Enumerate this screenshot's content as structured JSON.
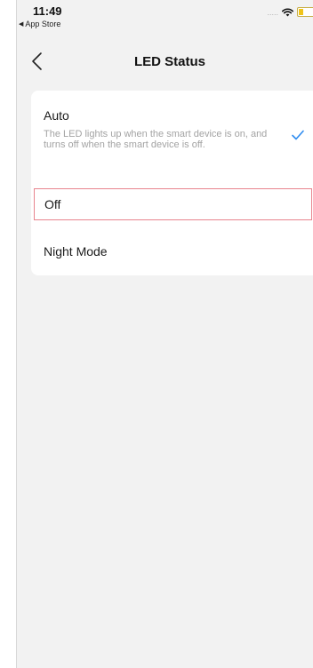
{
  "status_bar": {
    "time": "11:49",
    "back_app_label": "App Store",
    "signal": "....."
  },
  "nav": {
    "title": "LED Status",
    "back_icon": "chevron-left-icon"
  },
  "options": [
    {
      "title": "Auto",
      "description": "The LED lights up when the smart device is on, and turns off when the smart device is off.",
      "selected": true
    },
    {
      "title": "Off",
      "selected": false
    },
    {
      "title": "Night Mode",
      "selected": false
    }
  ],
  "colors": {
    "accent": "#2f8cf0",
    "background": "#f2f2f2",
    "card": "#ffffff",
    "highlight_border": "#e8848e"
  }
}
